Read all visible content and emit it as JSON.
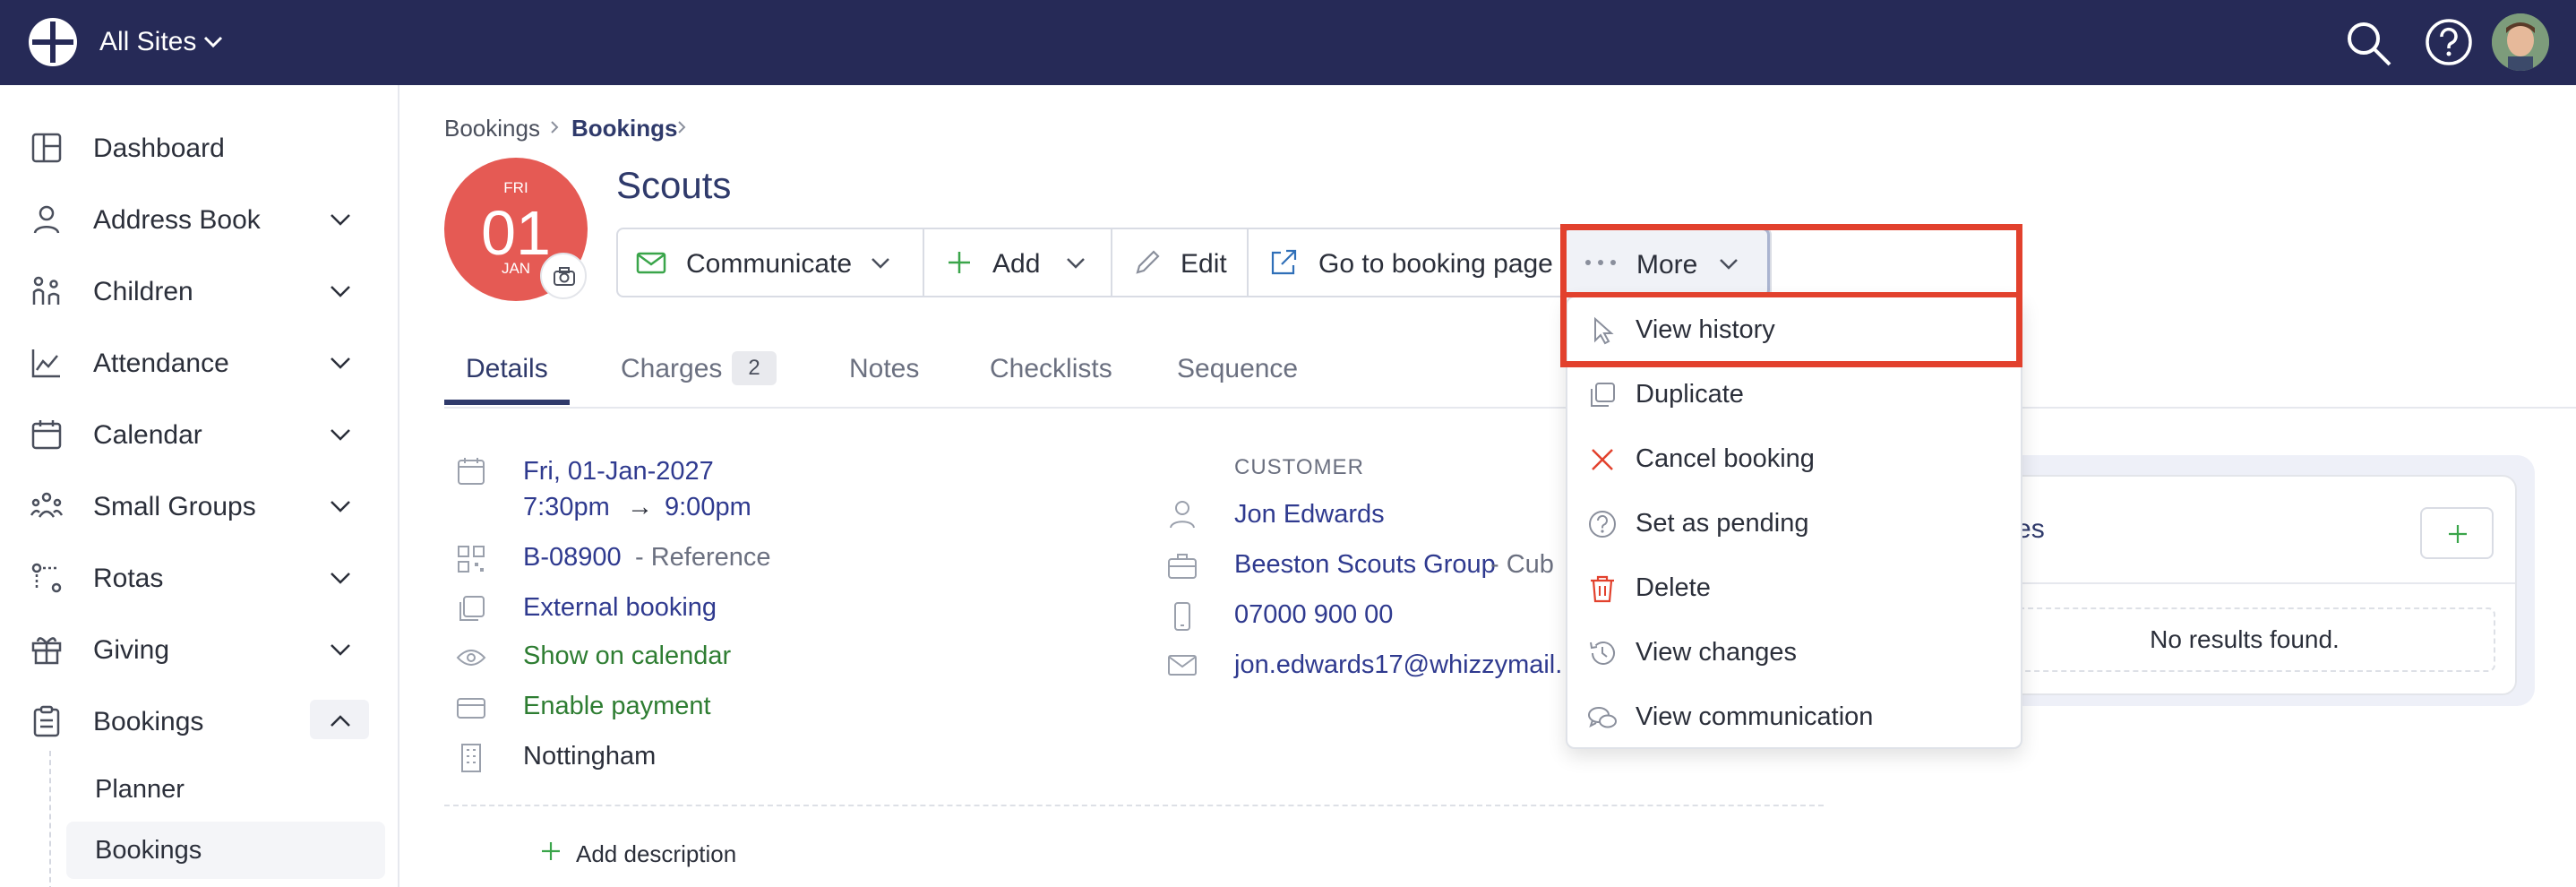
{
  "topbar": {
    "site_label": "All Sites"
  },
  "sidebar": {
    "items": [
      {
        "label": "Dashboard",
        "icon": "dashboard-icon",
        "has_chevron": false
      },
      {
        "label": "Address Book",
        "icon": "person-icon",
        "has_chevron": true
      },
      {
        "label": "Children",
        "icon": "children-icon",
        "has_chevron": true
      },
      {
        "label": "Attendance",
        "icon": "chart-icon",
        "has_chevron": true
      },
      {
        "label": "Calendar",
        "icon": "calendar-icon",
        "has_chevron": true
      },
      {
        "label": "Small Groups",
        "icon": "group-icon",
        "has_chevron": true
      },
      {
        "label": "Rotas",
        "icon": "rota-icon",
        "has_chevron": true
      },
      {
        "label": "Giving",
        "icon": "gift-icon",
        "has_chevron": true
      },
      {
        "label": "Bookings",
        "icon": "clipboard-icon",
        "has_chevron": true,
        "expanded": true
      }
    ],
    "sub_items": [
      {
        "label": "Planner",
        "active": false
      },
      {
        "label": "Bookings",
        "active": true
      }
    ]
  },
  "breadcrumb": [
    "Bookings",
    "Bookings"
  ],
  "date_badge": {
    "dow": "FRI",
    "day": "01",
    "month": "JAN"
  },
  "page_title": "Scouts",
  "toolbar": {
    "communicate": "Communicate",
    "add": "Add",
    "edit": "Edit",
    "go_to_booking": "Go to booking page",
    "more": "More"
  },
  "tabs": [
    {
      "label": "Details",
      "active": true
    },
    {
      "label": "Charges",
      "count": "2"
    },
    {
      "label": "Notes"
    },
    {
      "label": "Checklists"
    },
    {
      "label": "Sequence"
    }
  ],
  "details": {
    "date": "Fri, 01-Jan-2027",
    "time_start": "7:30pm",
    "arrow": "→",
    "time_end": "9:00pm",
    "reference_code": "B-08900",
    "reference_suffix": " - Reference",
    "external_booking": "External booking",
    "show_on_calendar": "Show on calendar",
    "enable_payment": "Enable payment",
    "location": "Nottingham",
    "add_description": "Add description"
  },
  "customer": {
    "heading": "CUSTOMER",
    "name": "Jon Edwards",
    "org": "Beeston Scouts Group",
    "org_suffix": " - Cub",
    "phone": "07000 900 00",
    "email": "jon.edwards17@whizzymail."
  },
  "notes_panel": {
    "title": "otes",
    "empty": "No results found."
  },
  "more_menu": [
    {
      "label": "View history",
      "icon": "cursor-icon",
      "color": "#8a8f9c"
    },
    {
      "label": "Duplicate",
      "icon": "duplicate-icon",
      "color": "#8a8f9c"
    },
    {
      "label": "Cancel booking",
      "icon": "x-icon",
      "color": "#e2412d"
    },
    {
      "label": "Set as pending",
      "icon": "question-icon",
      "color": "#8a8f9c"
    },
    {
      "label": "Delete",
      "icon": "trash-icon",
      "color": "#e2412d"
    },
    {
      "label": "View changes",
      "icon": "history-icon",
      "color": "#8a8f9c"
    },
    {
      "label": "View communication",
      "icon": "chat-icon",
      "color": "#8a8f9c"
    }
  ],
  "colors": {
    "topbar": "#262a57",
    "accent": "#2f3a6b",
    "badge": "#e55a54",
    "highlight": "#e2412d",
    "green": "#2e7d32"
  }
}
